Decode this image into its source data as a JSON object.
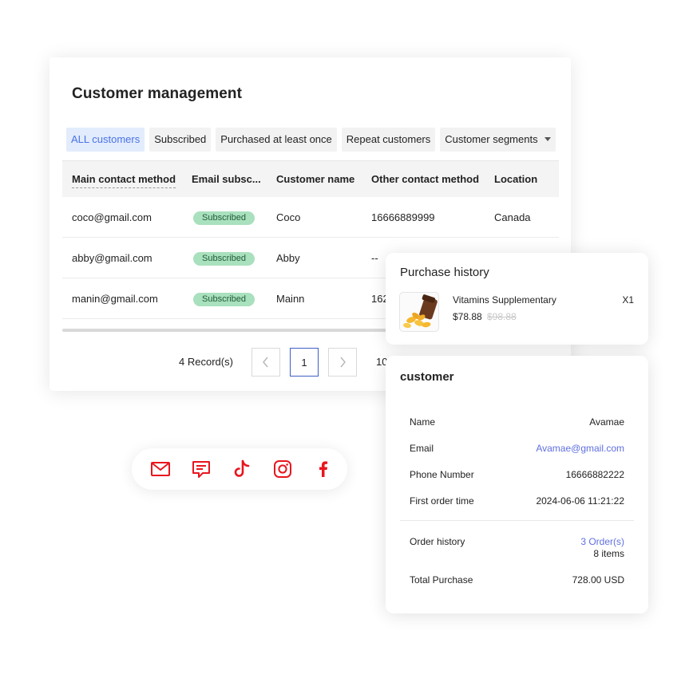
{
  "main": {
    "title": "Customer management",
    "tabs": [
      {
        "label": "ALL customers",
        "active": true
      },
      {
        "label": "Subscribed",
        "active": false
      },
      {
        "label": "Purchased at least once",
        "active": false
      },
      {
        "label": "Repeat customers",
        "active": false
      },
      {
        "label": "Customer segments",
        "active": false
      }
    ],
    "columns": [
      "Main contact method",
      "Email subsc...",
      "Customer name",
      "Other contact method",
      "Location"
    ],
    "rows": [
      {
        "contact": "coco@gmail.com",
        "subscription": "Subscribed",
        "name": "Coco",
        "other": "16666889999",
        "location": "Canada"
      },
      {
        "contact": "abby@gmail.com",
        "subscription": "Subscribed",
        "name": "Abby",
        "other": "--",
        "location": ""
      },
      {
        "contact": "manin@gmail.com",
        "subscription": "Subscribed",
        "name": "Mainn",
        "other": "162",
        "location": ""
      }
    ],
    "pagination": {
      "records": "4 Record(s)",
      "current_page": "1",
      "page_size": "10"
    }
  },
  "social": {
    "icons": [
      "email-icon",
      "sms-icon",
      "tiktok-icon",
      "instagram-icon",
      "facebook-icon"
    ],
    "color": "#e8161e"
  },
  "purchase_history": {
    "title": "Purchase history",
    "item_name": "Vitamins Supplementary",
    "quantity": "X1",
    "price": "$78.88",
    "original_price": "$98.88"
  },
  "customer": {
    "title": "customer",
    "fields": [
      {
        "label": "Name",
        "value": "Avamae"
      },
      {
        "label": "Email",
        "value": "Avamae@gmail.com"
      },
      {
        "label": "Phone Number",
        "value": "16666882222"
      },
      {
        "label": "First order time",
        "value": "2024-06-06 11:21:22"
      }
    ],
    "order_history_label": "Order history",
    "order_history_orders": "3 Order(s)",
    "order_history_items": "8 items",
    "total_label": "Total Purchase",
    "total_value": "728.00 USD"
  },
  "colors": {
    "accent": "#4a72e8",
    "badge_bg": "#a9e0bd",
    "link": "#5f6fe0"
  }
}
